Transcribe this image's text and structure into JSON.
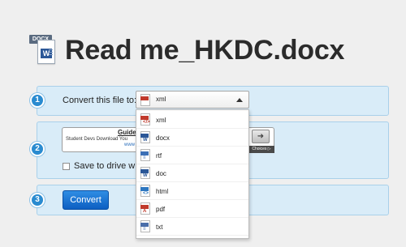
{
  "header": {
    "file_tag": "DOCX",
    "file_letter": "W",
    "title": "Read me_HKDC.docx"
  },
  "steps": {
    "step1": {
      "number": "1",
      "label": "Convert this file to:",
      "selected_format": "xml",
      "options": [
        "xml",
        "docx",
        "rtf",
        "doc",
        "html",
        "pdf",
        "txt"
      ]
    },
    "step2": {
      "number": "2",
      "guide_title": "Guide",
      "guide_sub": "Student Devs Download You",
      "guide_link": "www",
      "choices_label": "Choices ▷",
      "arrow_glyph": "➜",
      "checkbox_label": "Save to drive whe"
    },
    "step3": {
      "number": "3",
      "button_label": "Convert"
    }
  },
  "colors": {
    "accent": "#2a8bd0",
    "panel": "#d9ecf8",
    "button": "#1570d6"
  },
  "icons": {
    "xml": {
      "band": "#c0392b",
      "glyph": "</>"
    },
    "docx": {
      "band": "#2b5797",
      "glyph": "W"
    },
    "rtf": {
      "band": "#3b6fb6",
      "glyph": "≡"
    },
    "doc": {
      "band": "#2b5797",
      "glyph": "W"
    },
    "html": {
      "band": "#2e77c0",
      "glyph": "<>"
    },
    "pdf": {
      "band": "#c0392b",
      "glyph": "A"
    },
    "txt": {
      "band": "#4a6ea9",
      "glyph": "≡"
    }
  }
}
